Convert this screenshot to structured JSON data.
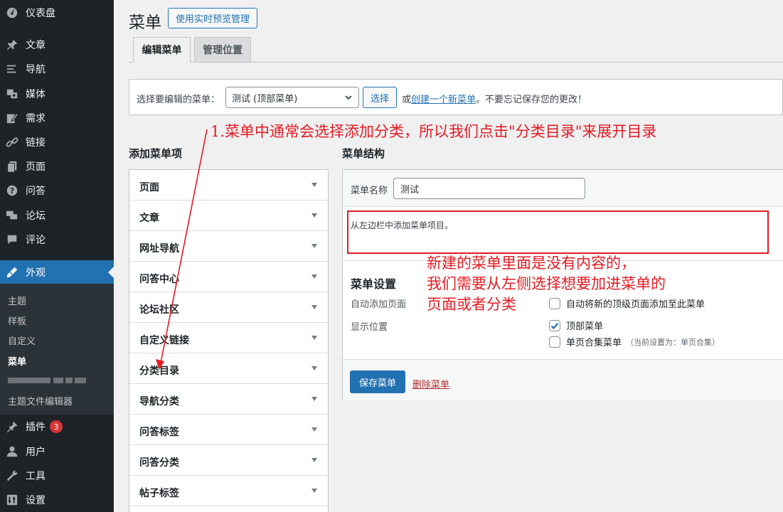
{
  "sidebar": {
    "items": [
      {
        "label": "仪表盘",
        "icon": "dashboard-icon"
      },
      {
        "label": "文章",
        "icon": "pin-icon"
      },
      {
        "label": "导航",
        "icon": "list-icon"
      },
      {
        "label": "媒体",
        "icon": "media-icon"
      },
      {
        "label": "需求",
        "icon": "edit-icon"
      },
      {
        "label": "链接",
        "icon": "link-icon"
      },
      {
        "label": "页面",
        "icon": "page-icon"
      },
      {
        "label": "问答",
        "icon": "question-icon"
      },
      {
        "label": "论坛",
        "icon": "forum-icon"
      },
      {
        "label": "评论",
        "icon": "comment-icon"
      },
      {
        "label": "外观",
        "icon": "appearance-icon"
      },
      {
        "label": "插件",
        "icon": "plugin-icon"
      },
      {
        "label": "用户",
        "icon": "user-icon"
      },
      {
        "label": "工具",
        "icon": "tools-icon"
      },
      {
        "label": "设置",
        "icon": "settings-icon"
      }
    ],
    "plugin_badge": "3",
    "submenu": [
      "主题",
      "样板",
      "自定义",
      "菜单",
      "主题文件编辑器"
    ]
  },
  "header": {
    "title": "菜单",
    "live_preview_button": "使用实时预览管理"
  },
  "tabs": [
    "编辑菜单",
    "管理位置"
  ],
  "select_bar": {
    "label": "选择要编辑的菜单：",
    "selected": "测试 (顶部菜单)",
    "select_button": "选择",
    "hint_prefix": "或",
    "hint_link": "创建一个新菜单",
    "hint_suffix": "。不要忘记保存您的更改！"
  },
  "add_items": {
    "heading": "添加菜单项",
    "items": [
      "页面",
      "文章",
      "网址导航",
      "问答中心",
      "论坛社区",
      "自定义链接",
      "分类目录",
      "导航分类",
      "问答标签",
      "问答分类",
      "帖子标签"
    ]
  },
  "structure": {
    "heading": "菜单结构",
    "name_label": "菜单名称",
    "name_value": "测试",
    "empty_instruction": "从左边栏中添加菜单项目。",
    "settings_title": "菜单设置",
    "auto_add_label": "自动添加页面",
    "auto_add_option": "自动将新的顶级页面添加至此菜单",
    "location_label": "显示位置",
    "locations": [
      {
        "label": "顶部菜单",
        "checked": true,
        "note": ""
      },
      {
        "label": "单页合集菜单",
        "checked": false,
        "note": "（当前设置为：单页合集）"
      }
    ],
    "save_button": "保存菜单",
    "delete_link": "删除菜单"
  },
  "annotations": {
    "step1": "1.菜单中通常会选择添加分类，所以我们点击\"分类目录\"来展开目录",
    "note_lines": [
      "新建的菜单里面是没有内容的，",
      "我们需要从左侧选择想要加进菜单的",
      "页面或者分类"
    ]
  },
  "colors": {
    "sidebar_bg": "#1d2327",
    "accent": "#2271b1",
    "annotation_red": "#e31c23",
    "badge_red": "#d63638"
  }
}
